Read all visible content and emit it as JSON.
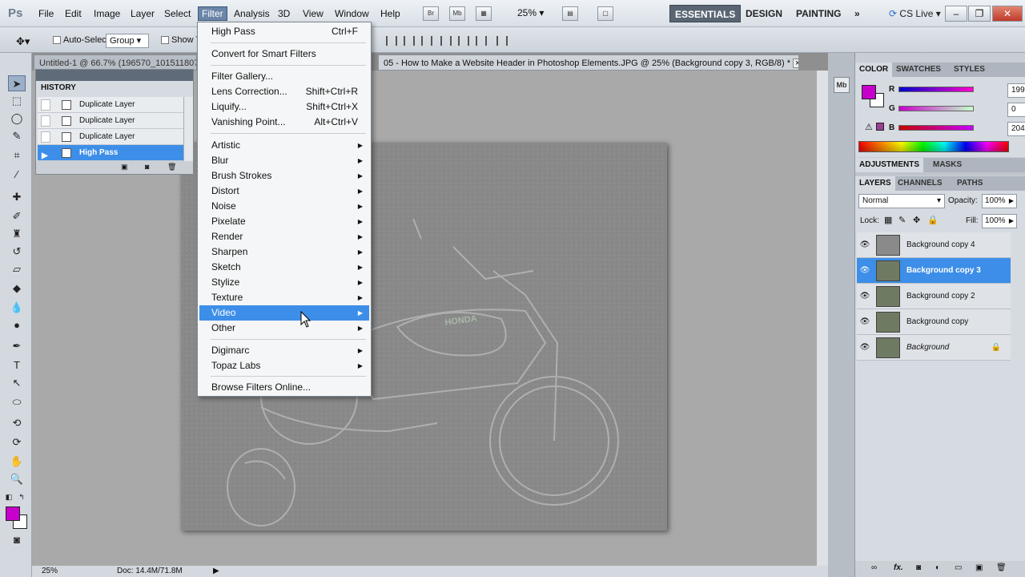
{
  "app": {
    "logo": "Ps"
  },
  "menubar": {
    "items": [
      "File",
      "Edit",
      "Image",
      "Layer",
      "Select",
      "Filter",
      "Analysis",
      "3D",
      "View",
      "Window",
      "Help"
    ],
    "active_item": "Filter",
    "bridge_icons": [
      "Br",
      "Mb"
    ],
    "zoom": "25%",
    "workspaces": [
      "ESSENTIALS",
      "DESIGN",
      "PAINTING"
    ],
    "active_workspace": "ESSENTIALS",
    "more": "»",
    "cs_live": "CS Live"
  },
  "options_bar": {
    "auto_select_label": "Auto-Select:",
    "auto_select_value": "Group",
    "show_label": "Show T"
  },
  "documents": {
    "tabs": [
      {
        "label": "Untitled-1 @ 66.7% (196570_1015118073"
      },
      {
        "label": "05 - How to Make a Website Header in Photoshop Elements.JPG @ 25% (Background copy 3, RGB/8) *"
      }
    ],
    "close": "×"
  },
  "status_bar": {
    "zoom": "25%",
    "doc_info": "Doc: 14.4M/71.8M"
  },
  "history": {
    "title": "HISTORY",
    "rows": [
      {
        "label": "Duplicate Layer",
        "selected": false
      },
      {
        "label": "Duplicate Layer",
        "selected": false
      },
      {
        "label": "Duplicate Layer",
        "selected": false
      },
      {
        "label": "High Pass",
        "selected": true
      }
    ]
  },
  "filter_menu": {
    "items": [
      {
        "label": "High Pass",
        "shortcut": "Ctrl+F",
        "submenu": false
      },
      {
        "label": "Convert for Smart Filters",
        "shortcut": "",
        "submenu": false
      },
      {
        "label": "Filter Gallery...",
        "shortcut": "",
        "submenu": false
      },
      {
        "label": "Lens Correction...",
        "shortcut": "Shift+Ctrl+R",
        "submenu": false
      },
      {
        "label": "Liquify...",
        "shortcut": "Shift+Ctrl+X",
        "submenu": false
      },
      {
        "label": "Vanishing Point...",
        "shortcut": "Alt+Ctrl+V",
        "submenu": false
      },
      {
        "label": "Artistic",
        "shortcut": "",
        "submenu": true
      },
      {
        "label": "Blur",
        "shortcut": "",
        "submenu": true
      },
      {
        "label": "Brush Strokes",
        "shortcut": "",
        "submenu": true
      },
      {
        "label": "Distort",
        "shortcut": "",
        "submenu": true
      },
      {
        "label": "Noise",
        "shortcut": "",
        "submenu": true
      },
      {
        "label": "Pixelate",
        "shortcut": "",
        "submenu": true
      },
      {
        "label": "Render",
        "shortcut": "",
        "submenu": true
      },
      {
        "label": "Sharpen",
        "shortcut": "",
        "submenu": true
      },
      {
        "label": "Sketch",
        "shortcut": "",
        "submenu": true
      },
      {
        "label": "Stylize",
        "shortcut": "",
        "submenu": true
      },
      {
        "label": "Texture",
        "shortcut": "",
        "submenu": true
      },
      {
        "label": "Video",
        "shortcut": "",
        "submenu": true
      },
      {
        "label": "Other",
        "shortcut": "",
        "submenu": true
      },
      {
        "label": "Digimarc",
        "shortcut": "",
        "submenu": true
      },
      {
        "label": "Topaz Labs",
        "shortcut": "",
        "submenu": true
      },
      {
        "label": "Browse Filters Online...",
        "shortcut": "",
        "submenu": false
      }
    ],
    "highlighted": "Video"
  },
  "color_panel": {
    "tabs": [
      "COLOR",
      "SWATCHES",
      "STYLES"
    ],
    "channels": [
      {
        "label": "R",
        "value": "199"
      },
      {
        "label": "G",
        "value": "0"
      },
      {
        "label": "B",
        "value": "204"
      }
    ],
    "foreground": "#c700cc"
  },
  "adjustments_panel": {
    "tabs": [
      "ADJUSTMENTS",
      "MASKS"
    ]
  },
  "layers_panel": {
    "tabs": [
      "LAYERS",
      "CHANNELS",
      "PATHS"
    ],
    "blend_mode": "Normal",
    "opacity_label": "Opacity:",
    "opacity": "100%",
    "lock_label": "Lock:",
    "fill_label": "Fill:",
    "fill": "100%",
    "layers": [
      {
        "name": "Background copy 4",
        "selected": false
      },
      {
        "name": "Background copy 3",
        "selected": true
      },
      {
        "name": "Background copy 2",
        "selected": false
      },
      {
        "name": "Background copy",
        "selected": false
      },
      {
        "name": "Background",
        "selected": false
      }
    ]
  },
  "colors": {
    "accent": "#3d8ee8",
    "foreground": "#c700cc"
  }
}
